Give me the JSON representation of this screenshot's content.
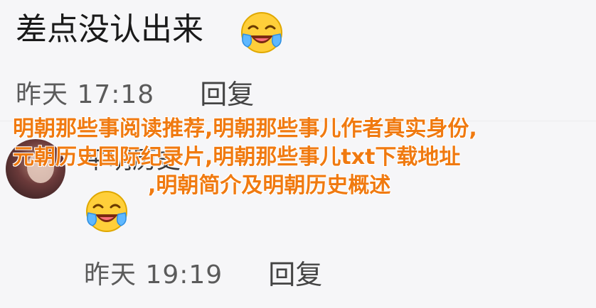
{
  "comments": [
    {
      "text": "差点没认出来",
      "emoji": "laughing-crying-emoji",
      "time": "昨天 17:18",
      "reply_label": "回复"
    },
    {
      "username": "平明历史",
      "emoji": "laughing-crying-emoji",
      "time": "昨天 19:19",
      "reply_label": "回复"
    }
  ],
  "overlay_title": {
    "line1": "明朝那些事阅读推荐,明朝那些事儿作者真实身份,",
    "line2": "元朝历史国际纪录片,明朝那些事儿txt下载地址",
    "line3": ",明朝简介及明朝历史概述"
  },
  "colors": {
    "overlay_text": "#f07a10",
    "background": "#f6f6f8",
    "meta_text": "#5b5b5b"
  }
}
